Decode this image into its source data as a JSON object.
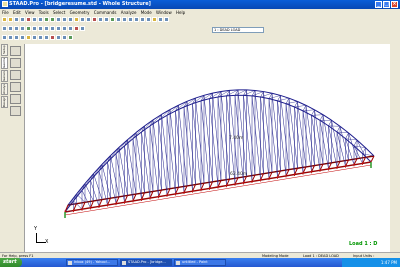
{
  "window": {
    "title": "STAAD.Pro - [bridgeresume.std - Whole Structure]"
  },
  "menu": [
    "File",
    "Edit",
    "View",
    "Tools",
    "Select",
    "Geometry",
    "Commands",
    "Analyze",
    "Mode",
    "Window",
    "Help"
  ],
  "toolbar": {
    "load_combo": "1 : DEAD LOAD"
  },
  "left_tabs": [
    "Setup",
    "Geometry",
    "General",
    "Analysis/Print",
    "Design"
  ],
  "viewport": {
    "axes_y": "Y",
    "axes_x": "X",
    "dim_height": "7.40m",
    "dim_span": "62.40m",
    "load_label": "Load 1 : D"
  },
  "status": {
    "left": "For Help, press F1",
    "mode": "Modeling Mode",
    "load": "Load 1 : DEAD LOAD",
    "units": "Input Units :"
  },
  "taskbar": {
    "start": "start",
    "tasks": [
      "Inbox (49) - Yahoo!...",
      "STAAD.Pro - [bridge...",
      "untitled - Paint"
    ],
    "clock": "1:47 PM"
  }
}
